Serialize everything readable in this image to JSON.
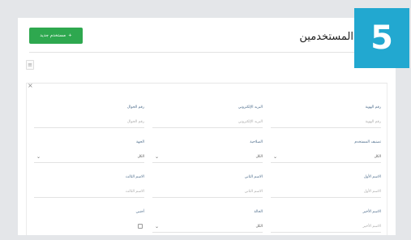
{
  "header": {
    "title": "المستخدمين",
    "add_button_label": "مستخدم جديد",
    "add_button_icon": "+"
  },
  "badge": {
    "number": "5",
    "color": "#22a8d0"
  },
  "colors": {
    "primary": "#2ea84f"
  },
  "filters": {
    "close_icon": "×",
    "filter_icon": "≡",
    "fields": [
      {
        "label": "رقم الهوية",
        "placeholder": "رقم الهوية",
        "type": "text"
      },
      {
        "label": "البريد الإلكتروني",
        "placeholder": "البريد الإلكتروني",
        "type": "text"
      },
      {
        "label": "رقم الجوال",
        "placeholder": "رقم الجوال",
        "type": "text"
      },
      {
        "label": "تصنيف المستخدم",
        "value": "الكل",
        "type": "select"
      },
      {
        "label": "الصلاحية",
        "value": "الكل",
        "type": "select"
      },
      {
        "label": "الجهة",
        "value": "الكل",
        "type": "select"
      },
      {
        "label": "الاسم الأول",
        "placeholder": "الاسم الأول",
        "type": "text"
      },
      {
        "label": "الاسم الثاني",
        "placeholder": "الاسم الثاني",
        "type": "text"
      },
      {
        "label": "الاسم الثالث",
        "placeholder": "الاسم الثالث",
        "type": "text"
      },
      {
        "label": "الاسم الأخير",
        "placeholder": "الاسم الأخير",
        "type": "text"
      },
      {
        "label": "الحالة",
        "value": "الكل",
        "type": "select"
      },
      {
        "label": "أجنبي",
        "type": "checkbox"
      }
    ]
  }
}
